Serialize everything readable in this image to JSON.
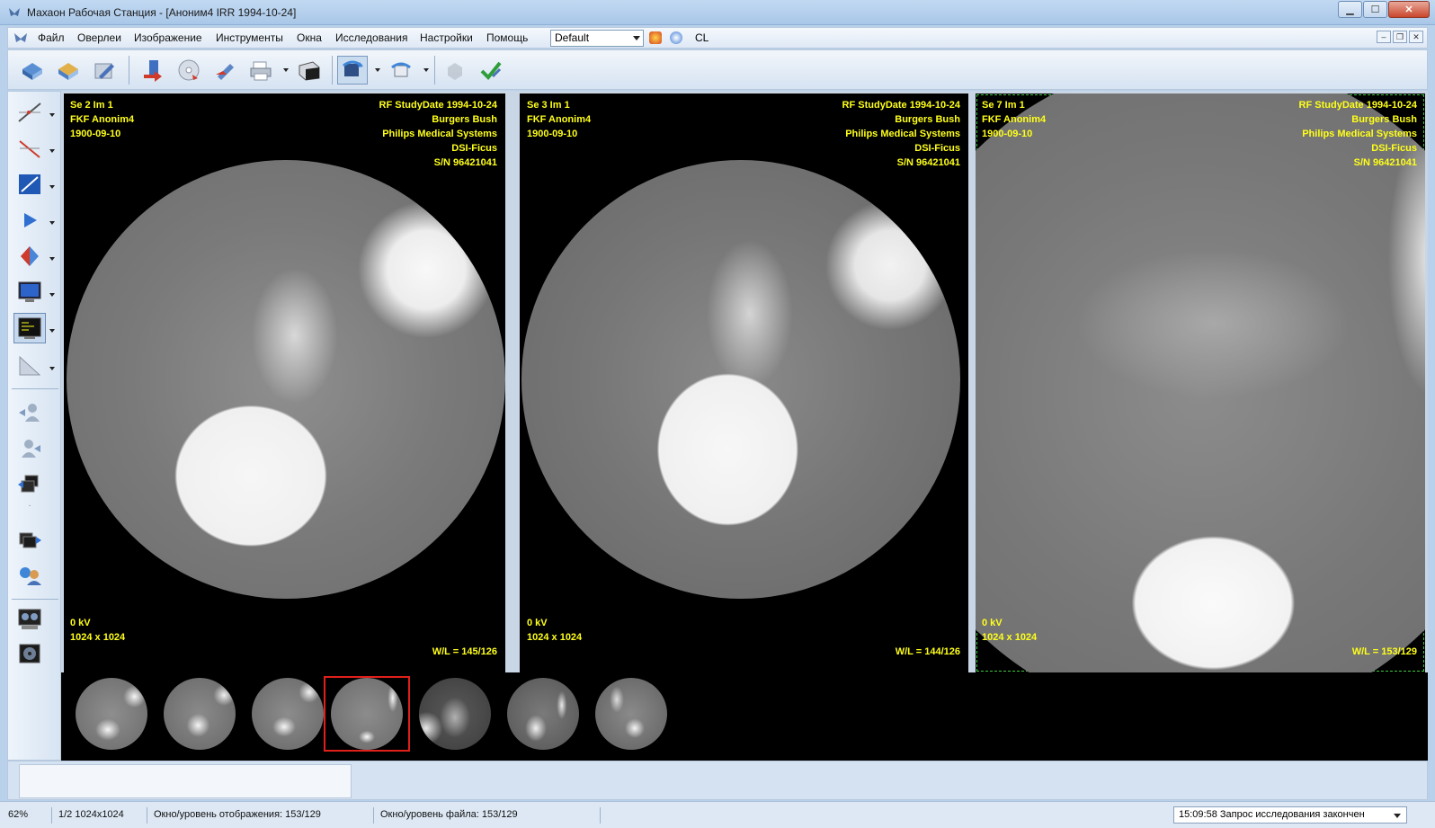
{
  "window": {
    "title": "Махаон Рабочая Станция - [Аноним4 IRR 1994-10-24]",
    "buttons": [
      "minimize",
      "maximize",
      "close"
    ]
  },
  "menu": {
    "items": [
      "Файл",
      "Оверлеи",
      "Изображение",
      "Инструменты",
      "Окна",
      "Исследования",
      "Настройки",
      "Помощь"
    ],
    "preset": "Default",
    "cl_label": "CL"
  },
  "toolbar": {
    "icons": [
      "open-study-icon",
      "open-folder-icon",
      "edit-icon",
      "export-icon",
      "burn-cd-icon",
      "send-icon",
      "print-icon",
      "scanner-icon",
      "rotate-icon",
      "flip-icon",
      "cube-icon",
      "check-icon"
    ]
  },
  "left_tools": {
    "icons": [
      "measure-line-icon",
      "measure-angle-icon",
      "roi-icon",
      "play-icon",
      "contrast-icon",
      "monitor-icon",
      "layout-icon",
      "curve-icon",
      "user-icon",
      "users-icon",
      "series-icon",
      "cine-icon",
      "compare-icon",
      "monitors-icon",
      "disk-icon"
    ]
  },
  "viewports": [
    {
      "top_left": [
        "Se 2 Im 1",
        "FKF Anonim4",
        "1900-09-10"
      ],
      "top_right": [
        "RF StudyDate 1994-10-24",
        "Burgers Bush",
        "Philips Medical Systems",
        "DSI-Ficus",
        "S/N 96421041"
      ],
      "bottom_left": [
        "0 kV",
        "1024 x 1024"
      ],
      "bottom_right": "W/L = 145/126",
      "active": false
    },
    {
      "top_left": [
        "Se 3 Im 1",
        "FKF Anonim4",
        "1900-09-10"
      ],
      "top_right": [
        "RF StudyDate 1994-10-24",
        "Burgers Bush",
        "Philips Medical Systems",
        "DSI-Ficus",
        "S/N 96421041"
      ],
      "bottom_left": [
        "0 kV",
        "1024 x 1024"
      ],
      "bottom_right": "W/L = 144/126",
      "active": false
    },
    {
      "top_left": [
        "Se 7 Im 1",
        "FKF Anonim4",
        "1900-09-10"
      ],
      "top_right": [
        "RF StudyDate 1994-10-24",
        "Burgers Bush",
        "Philips Medical Systems",
        "DSI-Ficus",
        "S/N 96421041"
      ],
      "bottom_left": [
        "0 kV",
        "1024 x 1024"
      ],
      "bottom_right": "W/L = 153/129",
      "active": true
    }
  ],
  "thumbnails": {
    "count": 7,
    "selected_index": 3
  },
  "status": {
    "zoom": "62%",
    "image": "1/2 1024x1024",
    "display_wl": "Окно/уровень отображения: 153/129",
    "file_wl": "Окно/уровень файла: 153/129",
    "message": "15:09:58 Запрос исследования закончен"
  },
  "colors": {
    "overlay_text": "#ffff1a",
    "active_border": "#3ec63e",
    "selected_thumb": "#e0201b"
  }
}
